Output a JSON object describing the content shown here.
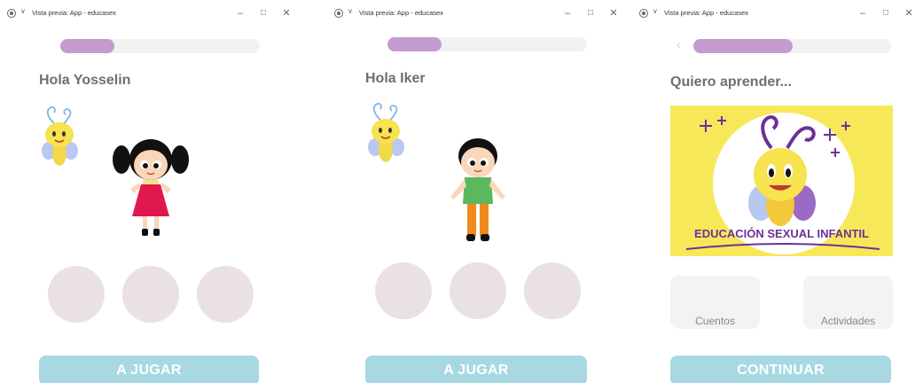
{
  "window_title": "Vista previa: App - educasex",
  "window_controls": {
    "minimize": "–",
    "maximize": "□",
    "close": "✕"
  },
  "accent_colors": {
    "progress_fill": "#c49bcf",
    "cta_button": "#a8d8e2",
    "circle": "#e9e1e3",
    "banner": "#f7e85a",
    "banner_text": "#6a3294"
  },
  "screens": [
    {
      "progress": 0.27,
      "greeting": "Hola Yosselin",
      "character": "girl-character",
      "cta": "A JUGAR"
    },
    {
      "progress": 0.27,
      "greeting": "Hola Iker",
      "character": "boy-character",
      "cta": "A JUGAR"
    },
    {
      "progress": 0.5,
      "greeting": "Quiero aprender...",
      "back_icon": "‹",
      "banner_text": "EDUCACIÓN SEXUAL INFANTIL",
      "options": [
        {
          "label": "Cuentos"
        },
        {
          "label": "Actividades"
        }
      ],
      "cta": "CONTINUAR"
    }
  ]
}
